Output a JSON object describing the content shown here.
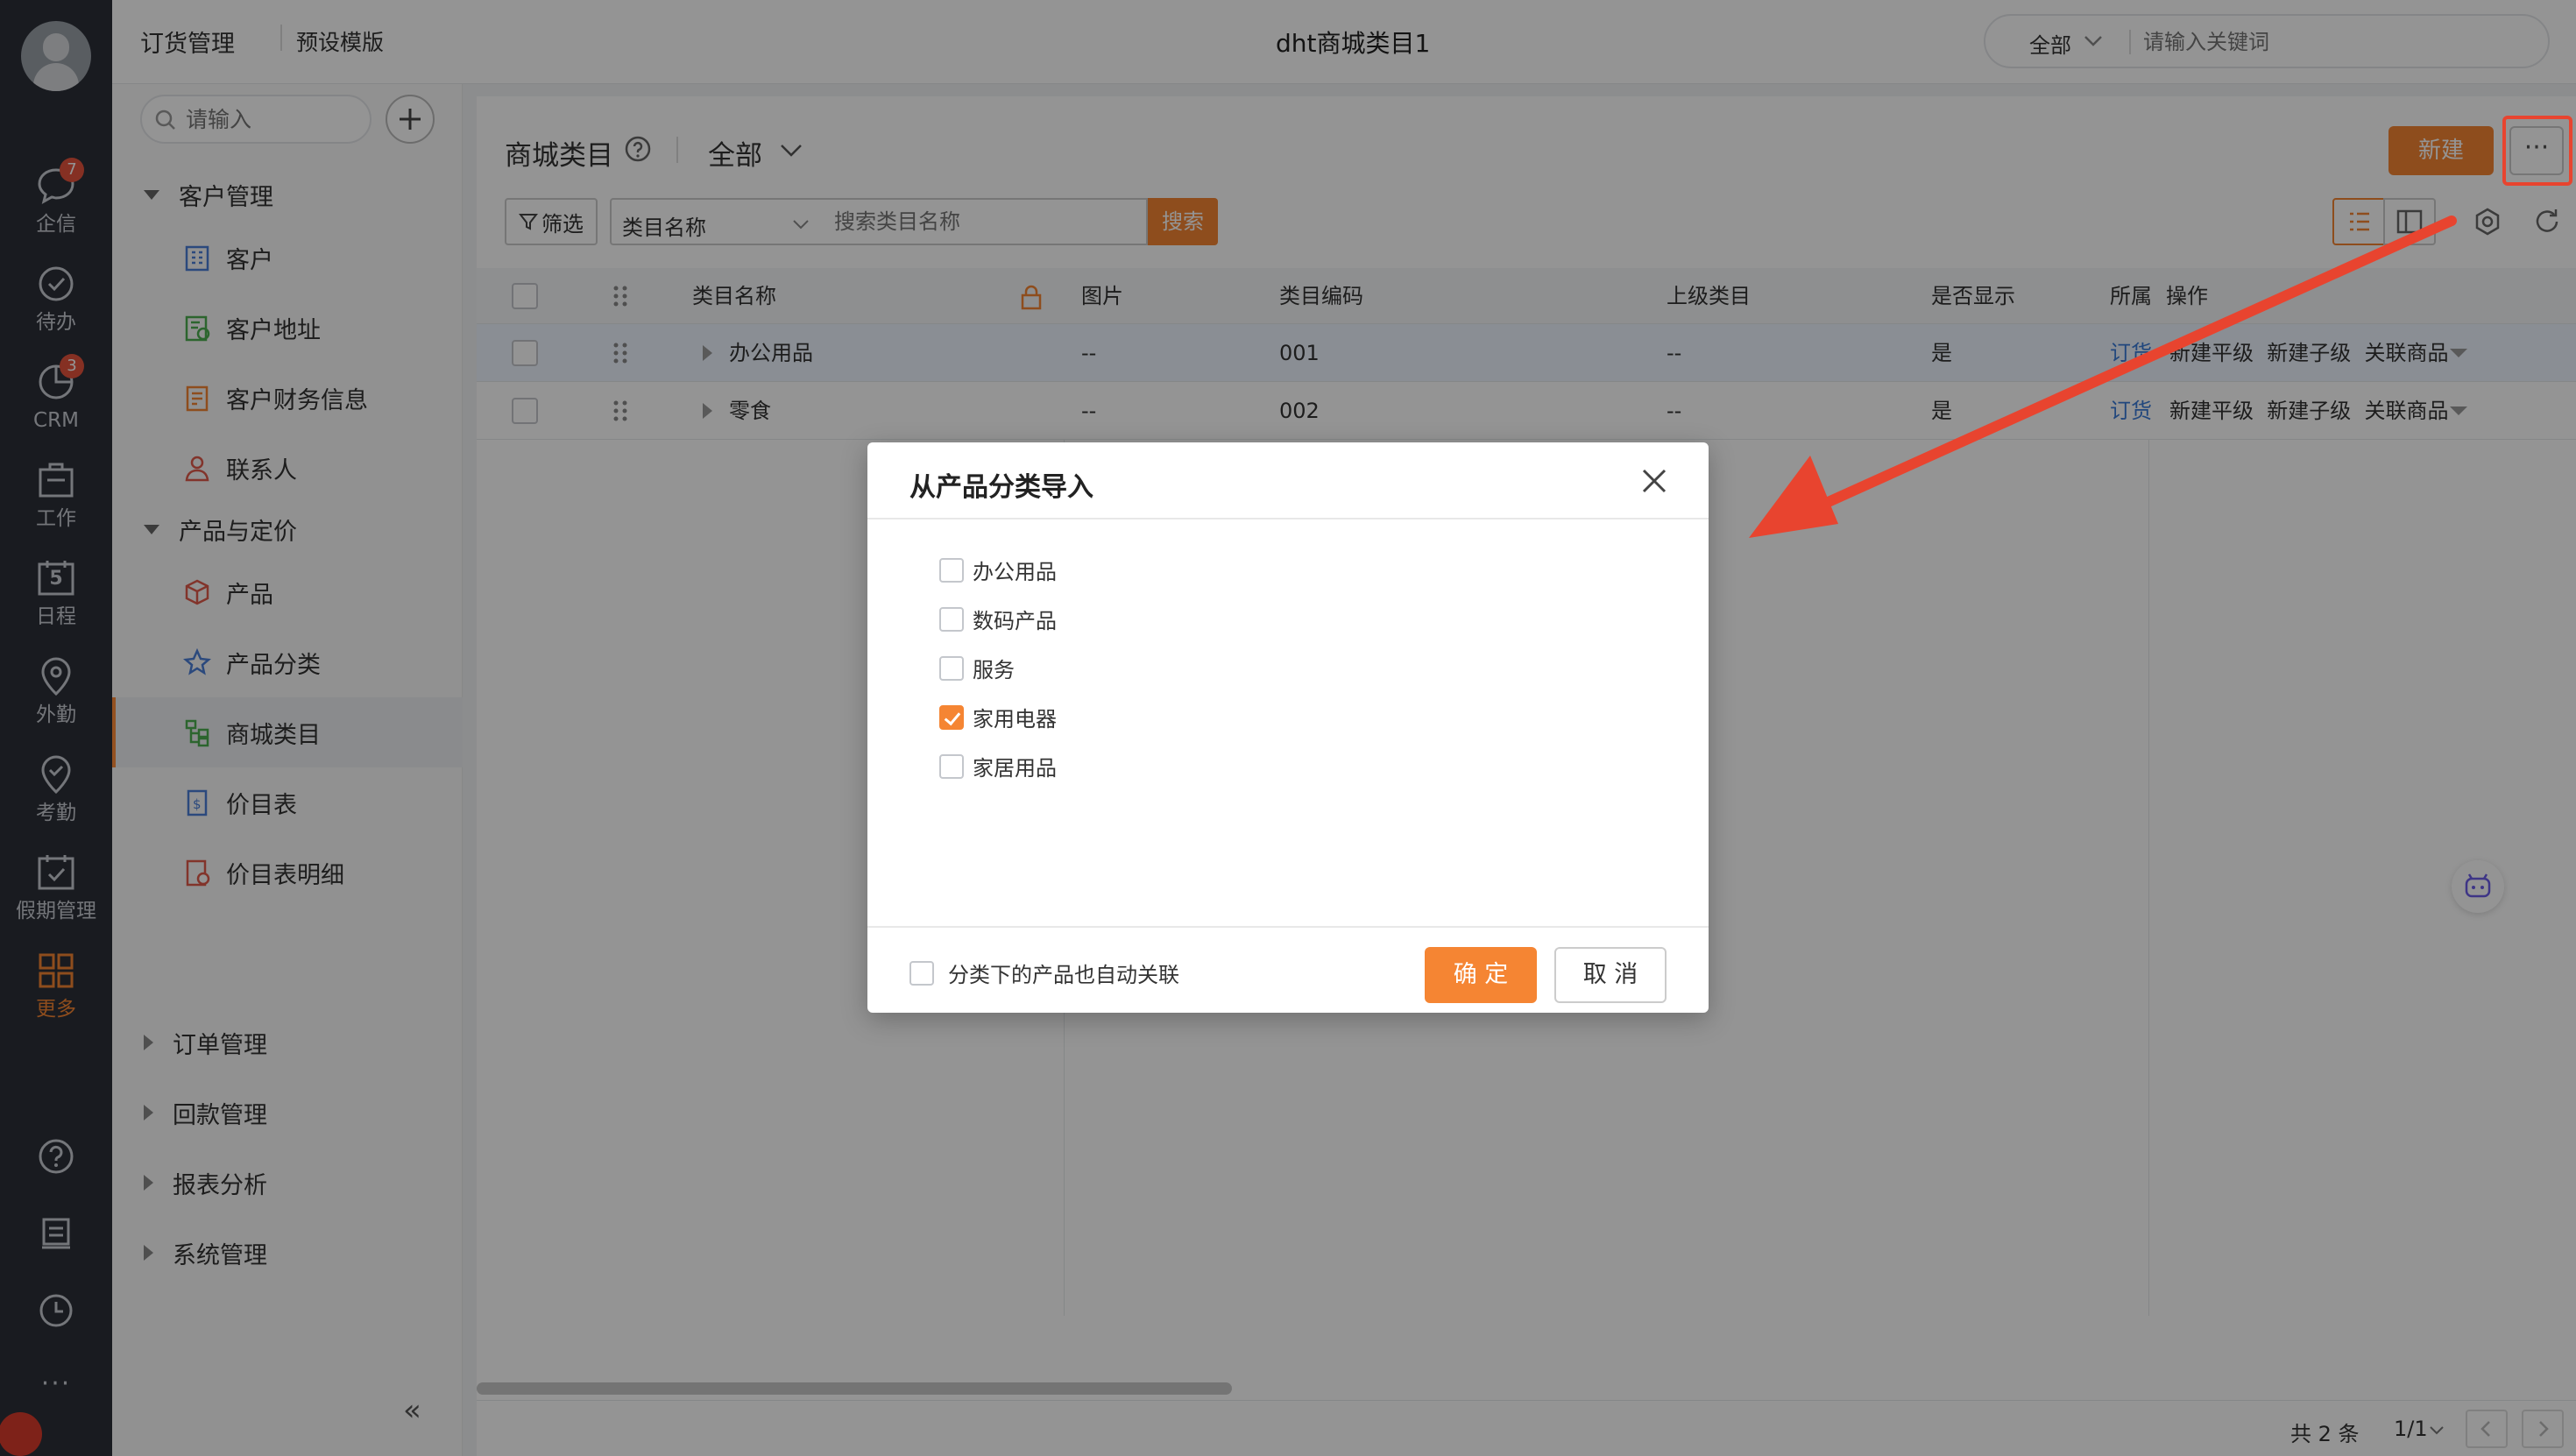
{
  "rail": {
    "items": [
      {
        "label": "企信",
        "badge": "7",
        "icon": "chat-icon"
      },
      {
        "label": "待办",
        "icon": "check-circle-icon"
      },
      {
        "label": "CRM",
        "badge": "3",
        "icon": "pie-chart-icon"
      },
      {
        "label": "工作",
        "icon": "briefcase-icon"
      },
      {
        "label": "日程",
        "icon": "calendar-icon",
        "day": "5"
      },
      {
        "label": "外勤",
        "icon": "location-icon"
      },
      {
        "label": "考勤",
        "icon": "attendance-icon"
      },
      {
        "label": "假期管理",
        "icon": "leave-icon"
      },
      {
        "label": "更多",
        "icon": "grid-icon"
      }
    ],
    "bottom_dots": "···"
  },
  "header": {
    "breadcrumb1": "订货管理",
    "breadcrumb2": "预设模版",
    "title": "dht商城类目1",
    "scope": "全部",
    "search_placeholder": "请输入关键词"
  },
  "sidebar": {
    "search_placeholder": "请输入",
    "groups": [
      {
        "label": "客户管理"
      },
      {
        "label": "产品与定价"
      },
      {
        "label": "订单管理"
      },
      {
        "label": "回款管理"
      },
      {
        "label": "报表分析"
      },
      {
        "label": "系统管理"
      }
    ],
    "items": [
      {
        "label": "客户"
      },
      {
        "label": "客户地址"
      },
      {
        "label": "客户财务信息"
      },
      {
        "label": "联系人"
      },
      {
        "label": "产品"
      },
      {
        "label": "产品分类"
      },
      {
        "label": "商城类目"
      },
      {
        "label": "价目表"
      },
      {
        "label": "价目表明细"
      }
    ],
    "collapse": "«"
  },
  "main": {
    "title": "商城类目",
    "view": "全部",
    "new_button": "新建",
    "more_button": "···",
    "filter_button": "筛选",
    "field_select": "类目名称",
    "search_placeholder": "搜索类目名称",
    "search_button": "搜索",
    "columns": [
      "类目名称",
      "图片",
      "类目编码",
      "上级类目",
      "是否显示",
      "所属",
      "操作"
    ],
    "rows": [
      {
        "name": "办公用品",
        "image": "--",
        "code": "001",
        "parent": "--",
        "visible": "是",
        "owner": "订货",
        "actions": "新建平级  新建子级  关联商品"
      },
      {
        "name": "零食",
        "image": "--",
        "code": "002",
        "parent": "--",
        "visible": "是",
        "owner": "订货",
        "actions": "新建平级  新建子级  关联商品"
      }
    ],
    "pagination": {
      "total": "共 2 条",
      "page": "1/1"
    }
  },
  "dialog": {
    "title": "从产品分类导入",
    "options": [
      {
        "label": "办公用品",
        "checked": false
      },
      {
        "label": "数码产品",
        "checked": false
      },
      {
        "label": "服务",
        "checked": false
      },
      {
        "label": "家用电器",
        "checked": true
      },
      {
        "label": "家居用品",
        "checked": false
      }
    ],
    "auto_link_label": "分类下的产品也自动关联",
    "confirm": "确 定",
    "cancel": "取 消"
  },
  "colors": {
    "accent": "#f58533",
    "annotation": "#e8442f",
    "rail_bg": "#2b2f38"
  }
}
